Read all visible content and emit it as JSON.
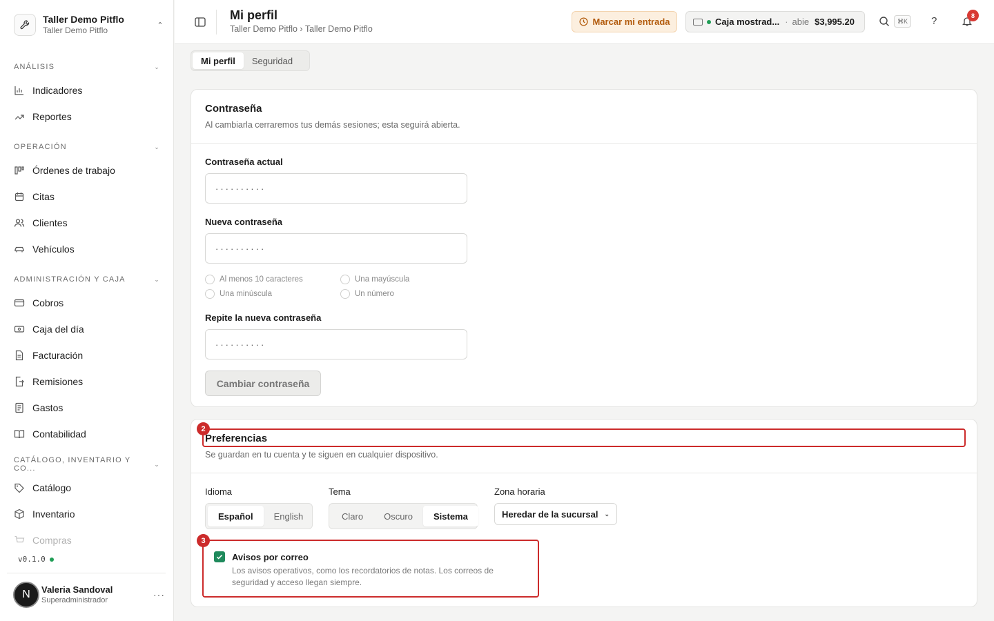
{
  "workspace": {
    "name": "Taller Demo Pitflo",
    "subtitle": "Taller Demo Pitflo"
  },
  "sidebar": {
    "sections": [
      {
        "title": "ANÁLISIS",
        "items": [
          {
            "label": "Indicadores",
            "icon": "bar-chart-icon"
          },
          {
            "label": "Reportes",
            "icon": "trend-up-icon"
          }
        ]
      },
      {
        "title": "OPERACIÓN",
        "items": [
          {
            "label": "Órdenes de trabajo",
            "icon": "kanban-icon"
          },
          {
            "label": "Citas",
            "icon": "calendar-icon"
          },
          {
            "label": "Clientes",
            "icon": "users-icon"
          },
          {
            "label": "Vehículos",
            "icon": "car-icon"
          }
        ]
      },
      {
        "title": "ADMINISTRACIÓN Y CAJA",
        "items": [
          {
            "label": "Cobros",
            "icon": "credit-card-icon"
          },
          {
            "label": "Caja del día",
            "icon": "banknote-icon"
          },
          {
            "label": "Facturación",
            "icon": "file-icon"
          },
          {
            "label": "Remisiones",
            "icon": "file-export-icon"
          },
          {
            "label": "Gastos",
            "icon": "receipt-icon"
          },
          {
            "label": "Contabilidad",
            "icon": "book-icon"
          }
        ]
      },
      {
        "title": "CATÁLOGO, INVENTARIO Y CO...",
        "items": [
          {
            "label": "Catálogo",
            "icon": "tag-icon"
          },
          {
            "label": "Inventario",
            "icon": "package-icon"
          },
          {
            "label": "Compras",
            "icon": "cart-icon"
          }
        ]
      }
    ],
    "version": "v0.1.0",
    "user": {
      "initial": "N",
      "name": "Valeria Sandoval",
      "role": "Superadministrador"
    }
  },
  "header": {
    "title": "Mi perfil",
    "breadcrumb": "Taller Demo Pitflo › Taller Demo Pitflo",
    "clock_in_label": "Marcar mi entrada",
    "cash": {
      "name": "Caja mostrad...",
      "separator": "·",
      "status": "abie",
      "amount": "$3,995.20"
    },
    "shortcut": "⌘K",
    "help": "?",
    "notifications": "8"
  },
  "tabs": [
    {
      "label": "Mi perfil",
      "active": true
    },
    {
      "label": "Seguridad",
      "active": false
    }
  ],
  "password_card": {
    "title": "Contraseña",
    "description": "Al cambiarla cerraremos tus demás sesiones; esta seguirá abierta.",
    "current_label": "Contraseña actual",
    "current_value": "··········",
    "new_label": "Nueva contraseña",
    "new_value": "··········",
    "requirements": [
      "Al menos 10 caracteres",
      "Una mayúscula",
      "Una minúscula",
      "Un número"
    ],
    "repeat_label": "Repite la nueva contraseña",
    "repeat_value": "··········",
    "submit_label": "Cambiar contraseña"
  },
  "preferences_card": {
    "title": "Preferencias",
    "description": "Se guardan en tu cuenta y te siguen en cualquier dispositivo.",
    "language_label": "Idioma",
    "languages": [
      "Español",
      "English"
    ],
    "theme_label": "Tema",
    "themes": [
      "Claro",
      "Oscuro",
      "Sistema"
    ],
    "timezone_label": "Zona horaria",
    "timezone_value": "Heredar de la sucursal",
    "email_notifications": {
      "checked": true,
      "title": "Avisos por correo",
      "description": "Los avisos operativos, como los recordatorios de notas. Los correos de seguridad y acceso llegan siempre."
    }
  },
  "annotations": [
    {
      "number": "2"
    },
    {
      "number": "3"
    }
  ],
  "colors": {
    "accent": "#1f8a5c",
    "annotation": "#cc2b2b",
    "warning": "#b25b0d",
    "badge": "#d83a34"
  }
}
